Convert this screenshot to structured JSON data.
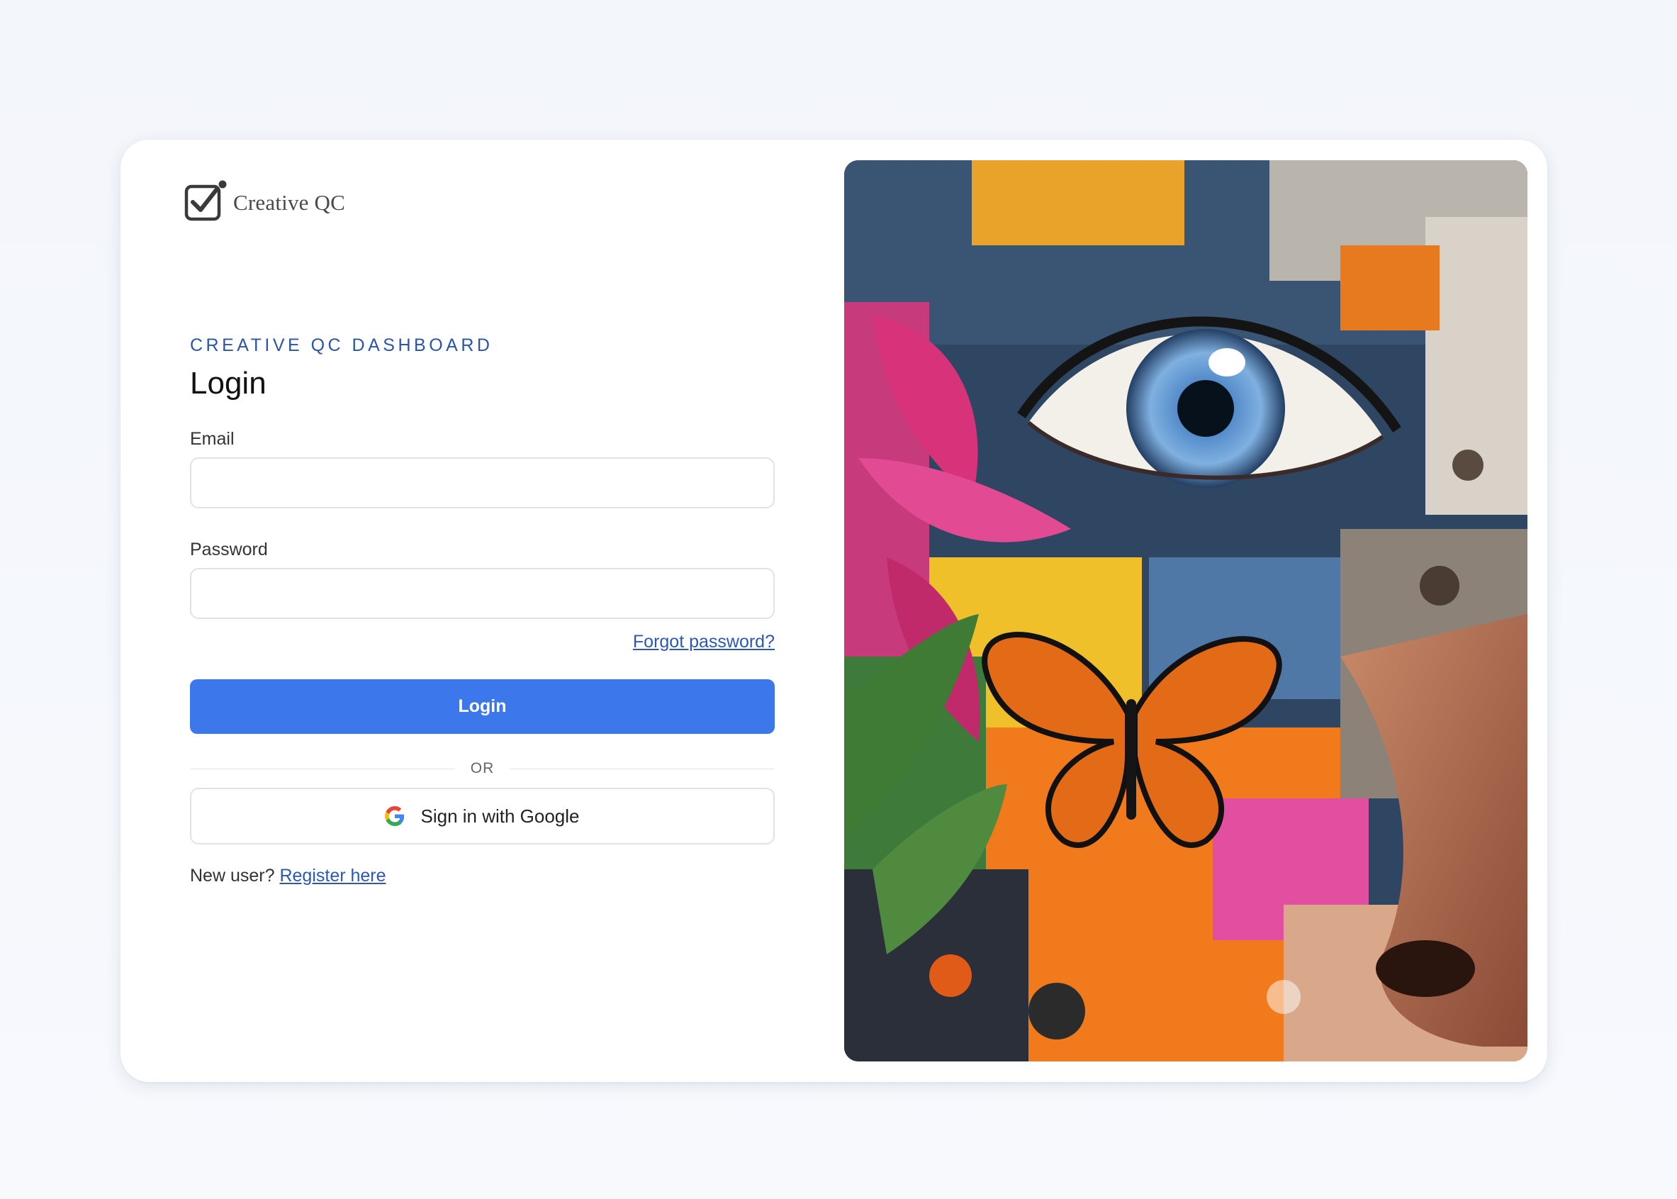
{
  "brand": {
    "name": "Creative QC",
    "logo_icon": "checkbox-check-icon"
  },
  "form": {
    "eyebrow": "CREATIVE QC DASHBOARD",
    "title": "Login",
    "email_label": "Email",
    "email_value": "",
    "password_label": "Password",
    "password_value": "",
    "forgot_password": "Forgot password?",
    "login_button": "Login",
    "divider_text": "OR",
    "google_button": "Sign in with Google",
    "google_icon": "google-g-icon",
    "new_user_text": "New user?",
    "register_link": "Register here"
  },
  "colors": {
    "accent": "#3c78ec",
    "eyebrow": "#2a55a8",
    "link": "#2c58b3",
    "background": "#f4f7fc"
  }
}
